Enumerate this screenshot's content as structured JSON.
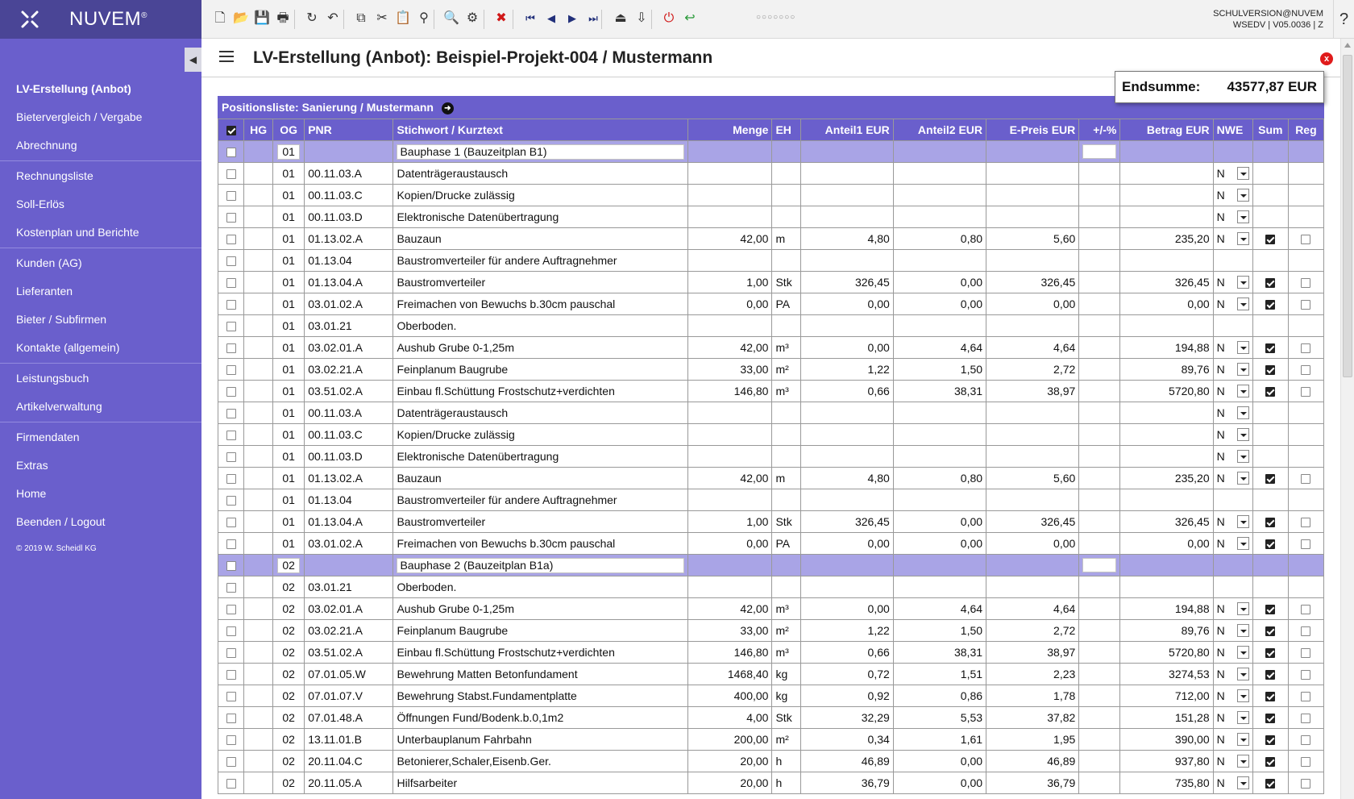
{
  "app": {
    "brand": "NUVEM",
    "brand_mark": "®",
    "copyright": "© 2019 W. Scheidl KG"
  },
  "user": {
    "line1": "SCHULVERSION@NUVEM",
    "line2": "WSEDV | V05.0036 | Z"
  },
  "help_label": "?",
  "close_label": "x",
  "page": {
    "title": "LV-Erstellung (Anbot): Beispiel-Projekt-004 / Mustermann"
  },
  "endsumme": {
    "label": "Endsumme:",
    "value": "43577,87 EUR"
  },
  "list_title": "Positionsliste: Sanierung / Mustermann",
  "toolbar_icons": [
    "new-document-icon",
    "open-folder-icon",
    "save-icon",
    "print-icon",
    "refresh-icon",
    "undo-icon",
    "copy-icon",
    "cut-icon",
    "paste-icon",
    "binoculars-icon",
    "search-icon",
    "settings-icon",
    "delete-icon",
    "first-icon",
    "previous-icon",
    "next-icon",
    "last-icon",
    "collapse-icon",
    "expand-icon",
    "power-icon",
    "back-icon"
  ],
  "nav": [
    {
      "label": "LV-Erstellung (Anbot)",
      "active": true
    },
    {
      "label": "Bietervergleich / Vergabe"
    },
    {
      "label": "Abrechnung",
      "sep": true
    },
    {
      "label": "Rechnungsliste"
    },
    {
      "label": "Soll-Erlös"
    },
    {
      "label": "Kostenplan und Berichte",
      "sep": true
    },
    {
      "label": "Kunden (AG)"
    },
    {
      "label": "Lieferanten"
    },
    {
      "label": "Bieter / Subfirmen"
    },
    {
      "label": "Kontakte (allgemein)",
      "sep": true
    },
    {
      "label": "Leistungsbuch"
    },
    {
      "label": "Artikelverwaltung",
      "sep": true
    },
    {
      "label": "Firmendaten"
    },
    {
      "label": "Extras"
    },
    {
      "label": "Home"
    },
    {
      "label": "Beenden / Logout"
    }
  ],
  "columns": [
    {
      "key": "sel",
      "label": "",
      "align": "c",
      "cls": "sel"
    },
    {
      "key": "hg",
      "label": "HG",
      "align": "c"
    },
    {
      "key": "og",
      "label": "OG",
      "align": "c"
    },
    {
      "key": "pnr",
      "label": "PNR"
    },
    {
      "key": "text",
      "label": "Stichwort / Kurztext"
    },
    {
      "key": "menge",
      "label": "Menge",
      "align": "r"
    },
    {
      "key": "eh",
      "label": "EH"
    },
    {
      "key": "a1",
      "label": "Anteil1 EUR",
      "align": "r"
    },
    {
      "key": "a2",
      "label": "Anteil2 EUR",
      "align": "r"
    },
    {
      "key": "ep",
      "label": "E-Preis EUR",
      "align": "r"
    },
    {
      "key": "pct",
      "label": "+/-%",
      "align": "r"
    },
    {
      "key": "betrag",
      "label": "Betrag EUR",
      "align": "r"
    },
    {
      "key": "nwe",
      "label": "NWE"
    },
    {
      "key": "sum",
      "label": "Sum",
      "align": "c"
    },
    {
      "key": "reg",
      "label": "Reg",
      "align": "c"
    }
  ],
  "header_checkbox_checked": true,
  "rows": [
    {
      "group": true,
      "og": "01",
      "text": "Bauphase 1 (Bauzeitplan B1)"
    },
    {
      "og": "01",
      "pnr": "00.11.03.A",
      "text": "Datenträgeraustausch",
      "nwe": "N"
    },
    {
      "og": "01",
      "pnr": "00.11.03.C",
      "text": "Kopien/Drucke zulässig",
      "nwe": "N"
    },
    {
      "og": "01",
      "pnr": "00.11.03.D",
      "text": "Elektronische Datenübertragung",
      "nwe": "N"
    },
    {
      "og": "01",
      "pnr": "01.13.02.A",
      "text": "Bauzaun",
      "menge": "42,00",
      "eh": "m",
      "a1": "4,80",
      "a2": "0,80",
      "ep": "5,60",
      "betrag": "235,20",
      "nwe": "N",
      "sum": true,
      "reg": false
    },
    {
      "og": "01",
      "pnr": "01.13.04",
      "text": "Baustromverteiler für andere Auftragnehmer"
    },
    {
      "og": "01",
      "pnr": "01.13.04.A",
      "text": "Baustromverteiler",
      "menge": "1,00",
      "eh": "Stk",
      "a1": "326,45",
      "a2": "0,00",
      "ep": "326,45",
      "betrag": "326,45",
      "nwe": "N",
      "sum": true,
      "reg": false
    },
    {
      "og": "01",
      "pnr": "03.01.02.A",
      "text": "Freimachen von Bewuchs b.30cm pauschal",
      "menge": "0,00",
      "eh": "PA",
      "a1": "0,00",
      "a2": "0,00",
      "ep": "0,00",
      "betrag": "0,00",
      "nwe": "N",
      "sum": true,
      "reg": false
    },
    {
      "og": "01",
      "pnr": "03.01.21",
      "text": "Oberboden."
    },
    {
      "og": "01",
      "pnr": "03.02.01.A",
      "text": "Aushub Grube 0-1,25m",
      "menge": "42,00",
      "eh": "m³",
      "a1": "0,00",
      "a2": "4,64",
      "ep": "4,64",
      "betrag": "194,88",
      "nwe": "N",
      "sum": true,
      "reg": false
    },
    {
      "og": "01",
      "pnr": "03.02.21.A",
      "text": "Feinplanum Baugrube",
      "menge": "33,00",
      "eh": "m²",
      "a1": "1,22",
      "a2": "1,50",
      "ep": "2,72",
      "betrag": "89,76",
      "nwe": "N",
      "sum": true,
      "reg": false
    },
    {
      "og": "01",
      "pnr": "03.51.02.A",
      "text": "Einbau fl.Schüttung Frostschutz+verdichten",
      "menge": "146,80",
      "eh": "m³",
      "a1": "0,66",
      "a2": "38,31",
      "ep": "38,97",
      "betrag": "5720,80",
      "nwe": "N",
      "sum": true,
      "reg": false
    },
    {
      "og": "01",
      "pnr": "00.11.03.A",
      "text": "Datenträgeraustausch",
      "nwe": "N"
    },
    {
      "og": "01",
      "pnr": "00.11.03.C",
      "text": "Kopien/Drucke zulässig",
      "nwe": "N"
    },
    {
      "og": "01",
      "pnr": "00.11.03.D",
      "text": "Elektronische Datenübertragung",
      "nwe": "N"
    },
    {
      "og": "01",
      "pnr": "01.13.02.A",
      "text": "Bauzaun",
      "menge": "42,00",
      "eh": "m",
      "a1": "4,80",
      "a2": "0,80",
      "ep": "5,60",
      "betrag": "235,20",
      "nwe": "N",
      "sum": true,
      "reg": false
    },
    {
      "og": "01",
      "pnr": "01.13.04",
      "text": "Baustromverteiler für andere Auftragnehmer"
    },
    {
      "og": "01",
      "pnr": "01.13.04.A",
      "text": "Baustromverteiler",
      "menge": "1,00",
      "eh": "Stk",
      "a1": "326,45",
      "a2": "0,00",
      "ep": "326,45",
      "betrag": "326,45",
      "nwe": "N",
      "sum": true,
      "reg": false
    },
    {
      "og": "01",
      "pnr": "03.01.02.A",
      "text": "Freimachen von Bewuchs b.30cm pauschal",
      "menge": "0,00",
      "eh": "PA",
      "a1": "0,00",
      "a2": "0,00",
      "ep": "0,00",
      "betrag": "0,00",
      "nwe": "N",
      "sum": true,
      "reg": false
    },
    {
      "group": true,
      "og": "02",
      "text": "Bauphase 2 (Bauzeitplan B1a)"
    },
    {
      "og": "02",
      "pnr": "03.01.21",
      "text": "Oberboden."
    },
    {
      "og": "02",
      "pnr": "03.02.01.A",
      "text": "Aushub Grube 0-1,25m",
      "menge": "42,00",
      "eh": "m³",
      "a1": "0,00",
      "a2": "4,64",
      "ep": "4,64",
      "betrag": "194,88",
      "nwe": "N",
      "sum": true,
      "reg": false
    },
    {
      "og": "02",
      "pnr": "03.02.21.A",
      "text": "Feinplanum Baugrube",
      "menge": "33,00",
      "eh": "m²",
      "a1": "1,22",
      "a2": "1,50",
      "ep": "2,72",
      "betrag": "89,76",
      "nwe": "N",
      "sum": true,
      "reg": false
    },
    {
      "og": "02",
      "pnr": "03.51.02.A",
      "text": "Einbau fl.Schüttung Frostschutz+verdichten",
      "menge": "146,80",
      "eh": "m³",
      "a1": "0,66",
      "a2": "38,31",
      "ep": "38,97",
      "betrag": "5720,80",
      "nwe": "N",
      "sum": true,
      "reg": false
    },
    {
      "og": "02",
      "pnr": "07.01.05.W",
      "text": "Bewehrung Matten Betonfundament",
      "menge": "1468,40",
      "eh": "kg",
      "a1": "0,72",
      "a2": "1,51",
      "ep": "2,23",
      "betrag": "3274,53",
      "nwe": "N",
      "sum": true,
      "reg": false
    },
    {
      "og": "02",
      "pnr": "07.01.07.V",
      "text": "Bewehrung Stabst.Fundamentplatte",
      "menge": "400,00",
      "eh": "kg",
      "a1": "0,92",
      "a2": "0,86",
      "ep": "1,78",
      "betrag": "712,00",
      "nwe": "N",
      "sum": true,
      "reg": false
    },
    {
      "og": "02",
      "pnr": "07.01.48.A",
      "text": "Öffnungen Fund/Bodenk.b.0,1m2",
      "menge": "4,00",
      "eh": "Stk",
      "a1": "32,29",
      "a2": "5,53",
      "ep": "37,82",
      "betrag": "151,28",
      "nwe": "N",
      "sum": true,
      "reg": false
    },
    {
      "og": "02",
      "pnr": "13.11.01.B",
      "text": "Unterbauplanum Fahrbahn",
      "menge": "200,00",
      "eh": "m²",
      "a1": "0,34",
      "a2": "1,61",
      "ep": "1,95",
      "betrag": "390,00",
      "nwe": "N",
      "sum": true,
      "reg": false
    },
    {
      "og": "02",
      "pnr": "20.11.04.C",
      "text": "Betonierer,Schaler,Eisenb.Ger.",
      "menge": "20,00",
      "eh": "h",
      "a1": "46,89",
      "a2": "0,00",
      "ep": "46,89",
      "betrag": "937,80",
      "nwe": "N",
      "sum": true,
      "reg": false
    },
    {
      "og": "02",
      "pnr": "20.11.05.A",
      "text": "Hilfsarbeiter",
      "menge": "20,00",
      "eh": "h",
      "a1": "36,79",
      "a2": "0,00",
      "ep": "36,79",
      "betrag": "735,80",
      "nwe": "N",
      "sum": true,
      "reg": false
    }
  ]
}
